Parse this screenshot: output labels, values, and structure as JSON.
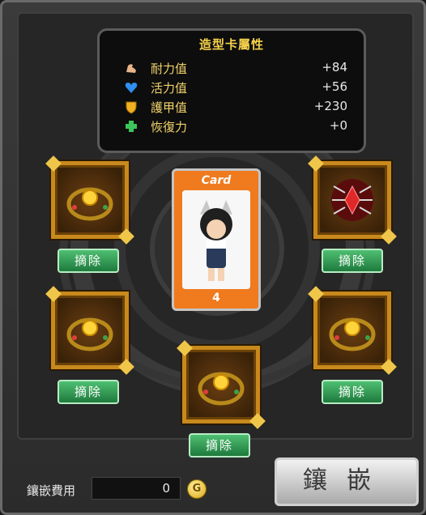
{
  "stats": {
    "title": "造型卡屬性",
    "rows": [
      {
        "label": "耐力值",
        "value": "+84",
        "icon": "arm-icon"
      },
      {
        "label": "活力值",
        "value": "+56",
        "icon": "heart-icon"
      },
      {
        "label": "護甲值",
        "value": "+230",
        "icon": "shield-icon"
      },
      {
        "label": "恢復力",
        "value": "+0",
        "icon": "cross-icon"
      }
    ]
  },
  "card": {
    "title": "Card",
    "number": "4"
  },
  "slots": [
    {
      "item": "gold-orb-necklace",
      "button": "摘除"
    },
    {
      "item": "red-spider-gem",
      "button": "摘除"
    },
    {
      "item": "gold-orb-necklace",
      "button": "摘除"
    },
    {
      "item": "gold-orb-necklace",
      "button": "摘除"
    },
    {
      "item": "gold-orb-necklace",
      "button": "摘除"
    }
  ],
  "footer": {
    "cost_label": "鑲嵌費用",
    "cost_value": "0",
    "coin_symbol": "G",
    "inlay_button": "鑲嵌"
  },
  "colors": {
    "accent_gold": "#f6d34b",
    "button_green": "#2e9b50",
    "card_orange": "#f07a1e"
  }
}
